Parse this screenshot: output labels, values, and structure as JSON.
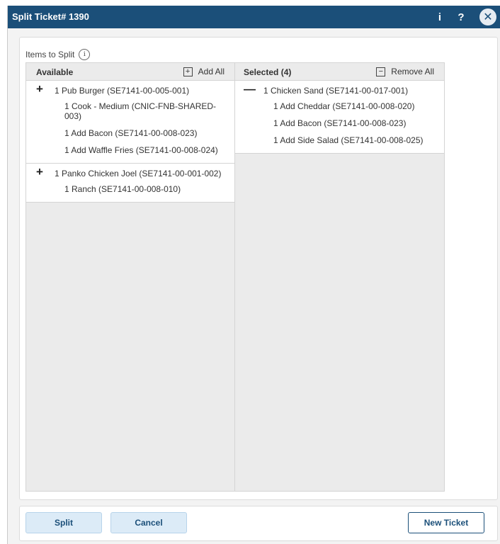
{
  "window": {
    "title": "Split Ticket# 1390",
    "info_icon": "i",
    "help_icon": "?",
    "close_icon": "✕"
  },
  "panel": {
    "label": "Items to Split",
    "info_glyph": "i"
  },
  "available": {
    "header": "Available",
    "action_label": "Add All",
    "action_glyph": "+",
    "groups": [
      {
        "toggle": "+",
        "label": "1 Pub Burger (SE7141-00-005-001)",
        "children": [
          "1 Cook - Medium (CNIC-FNB-SHARED-003)",
          "1 Add Bacon (SE7141-00-008-023)",
          "1 Add Waffle Fries (SE7141-00-008-024)"
        ]
      },
      {
        "toggle": "+",
        "label": "1 Panko Chicken Joel (SE7141-00-001-002)",
        "children": [
          "1 Ranch (SE7141-00-008-010)"
        ]
      }
    ]
  },
  "selected": {
    "header": "Selected (4)",
    "action_label": "Remove All",
    "action_glyph": "−",
    "groups": [
      {
        "toggle": "—",
        "label": "1 Chicken Sand (SE7141-00-017-001)",
        "children": [
          "1 Add Cheddar (SE7141-00-008-020)",
          "1 Add Bacon (SE7141-00-008-023)",
          "1 Add Side Salad (SE7141-00-008-025)"
        ]
      }
    ]
  },
  "footer": {
    "split_label": "Split",
    "cancel_label": "Cancel",
    "new_ticket_label": "New Ticket"
  },
  "colors": {
    "titlebar": "#1b4f79",
    "accent_button": "#dcebf7",
    "column_bg": "#ebebeb"
  }
}
